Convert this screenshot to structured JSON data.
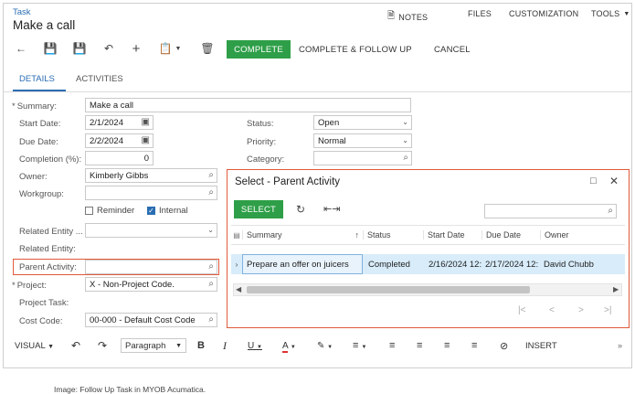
{
  "header": {
    "breadcrumb": "Task",
    "title": "Make a call",
    "nav": [
      "NOTES",
      "FILES",
      "CUSTOMIZATION",
      "TOOLS"
    ]
  },
  "toolbar": {
    "complete": "COMPLETE",
    "complete_follow_up": "COMPLETE & FOLLOW UP",
    "cancel": "CANCEL"
  },
  "tabs": [
    "DETAILS",
    "ACTIVITIES"
  ],
  "form": {
    "summary_label": "Summary:",
    "summary_value": "Make a call",
    "start_date_label": "Start Date:",
    "start_date_value": "2/1/2024",
    "due_date_label": "Due Date:",
    "due_date_value": "2/2/2024",
    "completion_label": "Completion (%):",
    "completion_value": "0",
    "owner_label": "Owner:",
    "owner_value": "Kimberly Gibbs",
    "workgroup_label": "Workgroup:",
    "workgroup_value": "",
    "reminder_label": "Reminder",
    "internal_label": "Internal",
    "related_entity_type_label": "Related Entity ...",
    "related_entity_label": "Related Entity:",
    "parent_activity_label": "Parent Activity:",
    "parent_activity_value": "",
    "project_label": "Project:",
    "project_value": "X - Non-Project Code.",
    "project_task_label": "Project Task:",
    "cost_code_label": "Cost Code:",
    "cost_code_value": "00-000 - Default Cost Code",
    "status_label": "Status:",
    "status_value": "Open",
    "priority_label": "Priority:",
    "priority_value": "Normal",
    "category_label": "Category:",
    "category_value": ""
  },
  "editor": {
    "mode": "VISUAL",
    "paragraph": "Paragraph",
    "insert": "INSERT"
  },
  "popup": {
    "title": "Select - Parent Activity",
    "select_button": "SELECT",
    "search_placeholder": "",
    "columns": [
      "Summary",
      "Status",
      "Start Date",
      "Due Date",
      "Owner"
    ],
    "rows": [
      {
        "summary": "Prepare an offer on juicers",
        "status": "Completed",
        "start_date": "2/16/2024 12:",
        "due_date": "2/17/2024 12:",
        "owner": "David Chubb"
      }
    ]
  },
  "caption": "Image: Follow Up Task in MYOB Acumatica.",
  "colors": {
    "accent": "#2a6db3",
    "primary_button": "#2e9f48",
    "highlight": "#e05a3a",
    "selected_row": "#d8ecfa"
  }
}
